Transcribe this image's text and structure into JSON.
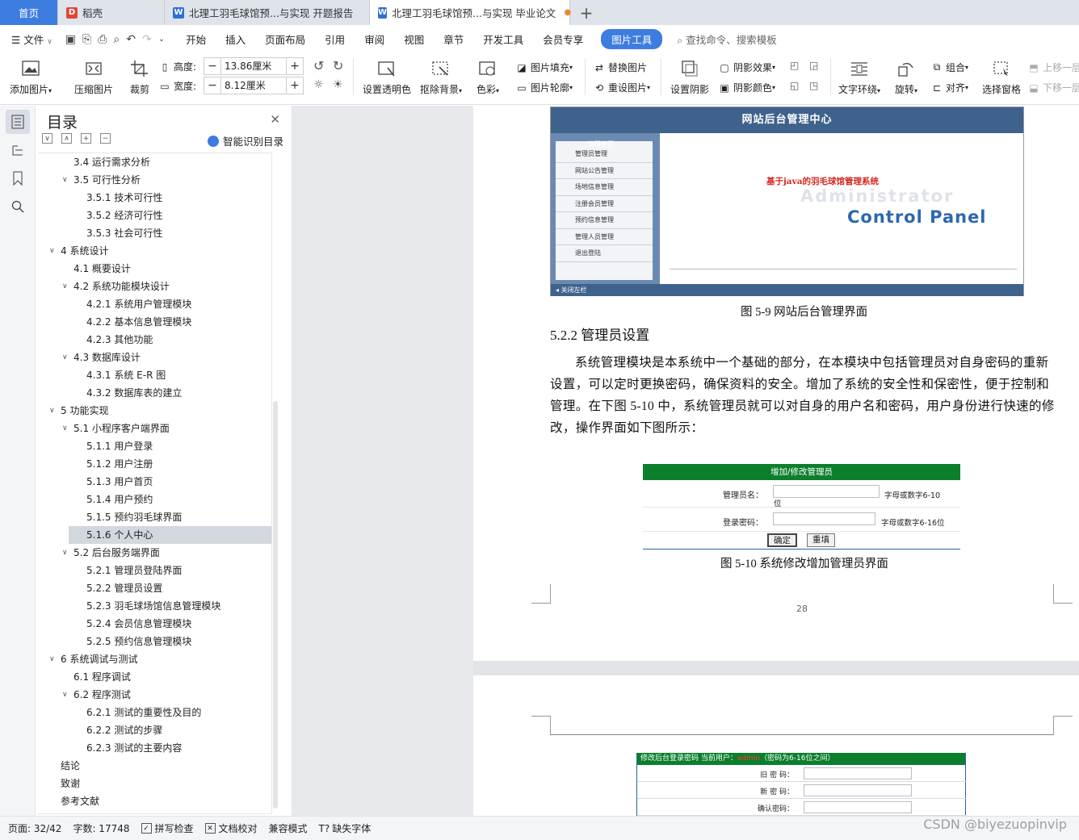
{
  "tabs": [
    {
      "label": "首页",
      "type": "home"
    },
    {
      "label": "稻壳",
      "icon": "docer-icon"
    },
    {
      "label": "北理工羽毛球馆预...与实现 开题报告",
      "icon": "word-doc-icon"
    },
    {
      "label": "北理工羽毛球馆预...与实现 毕业论文",
      "icon": "word-doc-icon",
      "active": true
    }
  ],
  "menu": {
    "file": "文件",
    "items": [
      "开始",
      "插入",
      "页面布局",
      "引用",
      "审阅",
      "视图",
      "章节",
      "开发工具",
      "会员专享"
    ],
    "active_pill": "图片工具",
    "search": "查找命令、搜索模板"
  },
  "ribbon": {
    "add_picture": "添加图片",
    "compress": "压缩图片",
    "crop": "裁剪",
    "height_label": "高度:",
    "height_value": "13.86厘米",
    "width_label": "宽度:",
    "width_value": "8.12厘米",
    "transparent": "设置透明色",
    "remove_bg": "抠除背景",
    "color": "色彩",
    "fill": "图片填充",
    "outline": "图片轮廓",
    "replace": "替换图片",
    "reset": "重设图片",
    "shadow": "设置阴影",
    "shadow_effect": "阴影效果",
    "shadow_color": "阴影颜色",
    "wrap": "文字环绕",
    "rotate": "旋转",
    "group": "组合",
    "align": "对齐",
    "selection_pane": "选择窗格",
    "move_up": "上移一层",
    "move_down": "下移一层"
  },
  "toc": {
    "title": "目录",
    "smart": "智能识别目录",
    "items": [
      {
        "text": "3.4  运行需求分析",
        "level": 2,
        "arrow": false
      },
      {
        "text": "3.5  可行性分析",
        "level": 2,
        "arrow": true
      },
      {
        "text": "3.5.1 技术可行性",
        "level": 3,
        "arrow": false
      },
      {
        "text": "3.5.2 经济可行性",
        "level": 3,
        "arrow": false
      },
      {
        "text": "3.5.3 社会可行性",
        "level": 3,
        "arrow": false
      },
      {
        "text": "4  系统设计",
        "level": 1,
        "arrow": true
      },
      {
        "text": "4.1  概要设计",
        "level": 2,
        "arrow": false
      },
      {
        "text": "4.2  系统功能模块设计",
        "level": 2,
        "arrow": true
      },
      {
        "text": "4.2.1  系统用户管理模块",
        "level": 3,
        "arrow": false
      },
      {
        "text": "4.2.2  基本信息管理模块",
        "level": 3,
        "arrow": false
      },
      {
        "text": "4.2.3  其他功能",
        "level": 3,
        "arrow": false
      },
      {
        "text": "4.3  数据库设计",
        "level": 2,
        "arrow": true
      },
      {
        "text": "4.3.1  系统 E-R 图",
        "level": 3,
        "arrow": false
      },
      {
        "text": "4.3.2  数据库表的建立",
        "level": 3,
        "arrow": false
      },
      {
        "text": "5  功能实现",
        "level": 1,
        "arrow": true
      },
      {
        "text": "5.1  小程序客户端界面",
        "level": 2,
        "arrow": true
      },
      {
        "text": "5.1.1 用户登录",
        "level": 3,
        "arrow": false
      },
      {
        "text": "5.1.2  用户注册",
        "level": 3,
        "arrow": false
      },
      {
        "text": "5.1.3  用户首页",
        "level": 3,
        "arrow": false
      },
      {
        "text": "5.1.4  用户预约",
        "level": 3,
        "arrow": false
      },
      {
        "text": "5.1.5  预约羽毛球界面",
        "level": 3,
        "arrow": false
      },
      {
        "text": "5.1.6  个人中心",
        "level": 3,
        "arrow": false,
        "selected": true
      },
      {
        "text": "5.2  后台服务端界面",
        "level": 2,
        "arrow": true
      },
      {
        "text": "5.2.1  管理员登陆界面",
        "level": 3,
        "arrow": false
      },
      {
        "text": "5.2.2  管理员设置",
        "level": 3,
        "arrow": false
      },
      {
        "text": "5.2.3  羽毛球场馆信息管理模块",
        "level": 3,
        "arrow": false
      },
      {
        "text": "5.2.4  会员信息管理模块",
        "level": 3,
        "arrow": false
      },
      {
        "text": "5.2.5  预约信息管理模块",
        "level": 3,
        "arrow": false
      },
      {
        "text": "6  系统调试与测试",
        "level": 1,
        "arrow": true
      },
      {
        "text": "6.1  程序调试",
        "level": 2,
        "arrow": false
      },
      {
        "text": "6.2  程序测试",
        "level": 2,
        "arrow": true
      },
      {
        "text": "6.2.1  测试的重要性及目的",
        "level": 3,
        "arrow": false
      },
      {
        "text": "6.2.2  测试的步骤",
        "level": 3,
        "arrow": false
      },
      {
        "text": "6.2.3  测试的主要内容",
        "level": 3,
        "arrow": false
      },
      {
        "text": "结论",
        "level": 1,
        "arrow": false
      },
      {
        "text": "致谢",
        "level": 1,
        "arrow": false
      },
      {
        "text": "参考文献",
        "level": 1,
        "arrow": false
      }
    ]
  },
  "doc": {
    "fig1": {
      "header": "网站后台管理中心",
      "menu_top": "管理首页",
      "menu": [
        "管理员管理",
        "网站公告管理",
        "场地信息管理",
        "注册会员管理",
        "预约信息管理",
        "管理人员管理",
        "退出登陆"
      ],
      "line1": "基于java的羽毛球馆管理系统",
      "line2": "Administrator",
      "line3": "Control Panel",
      "footer": "关闭左栏"
    },
    "caption1": "图 5-9 网站后台管理界面",
    "heading": "5.2.2  管理员设置",
    "paragraph": "系统管理模块是本系统中一个基础的部分，在本模块中包括管理员对自身密码的重新设置，可以定时更换密码，确保资料的安全。增加了系统的安全性和保密性，便于控制和管理。在下图 5-10 中，系统管理员就可以对自身的用户名和密码，用户身份进行快速的修改，操作界面如下图所示：",
    "fig2": {
      "header": "增加/修改管理员",
      "name_label": "管理员名：",
      "name_hint": "字母或数字6-10",
      "name_hint_wrap": "位",
      "pwd_label": "登录密码：",
      "pwd_hint": "字母或数字6-16位",
      "ok": "确定",
      "reset": "重填"
    },
    "caption2": "图 5-10 系统修改增加管理员界面",
    "page_number": "28",
    "fig3": {
      "header_a": "修改后台登录密码  当前用户：",
      "header_user": "admin",
      "header_b": "（密码为6-16位之间）",
      "old": "旧 密 码：",
      "new": "新 密 码：",
      "confirm": "确认密码："
    }
  },
  "status": {
    "page": "页面: 32/42",
    "words": "字数: 17748",
    "spell": "拼写检查",
    "proof": "文档校对",
    "compat": "兼容模式",
    "missing_font": "缺失字体"
  },
  "watermark": "CSDN @biyezuopinvip",
  "colors": {
    "accent": "#3d7de0",
    "green_header": "#0b7f2c",
    "admin_blue": "#3f628c"
  }
}
